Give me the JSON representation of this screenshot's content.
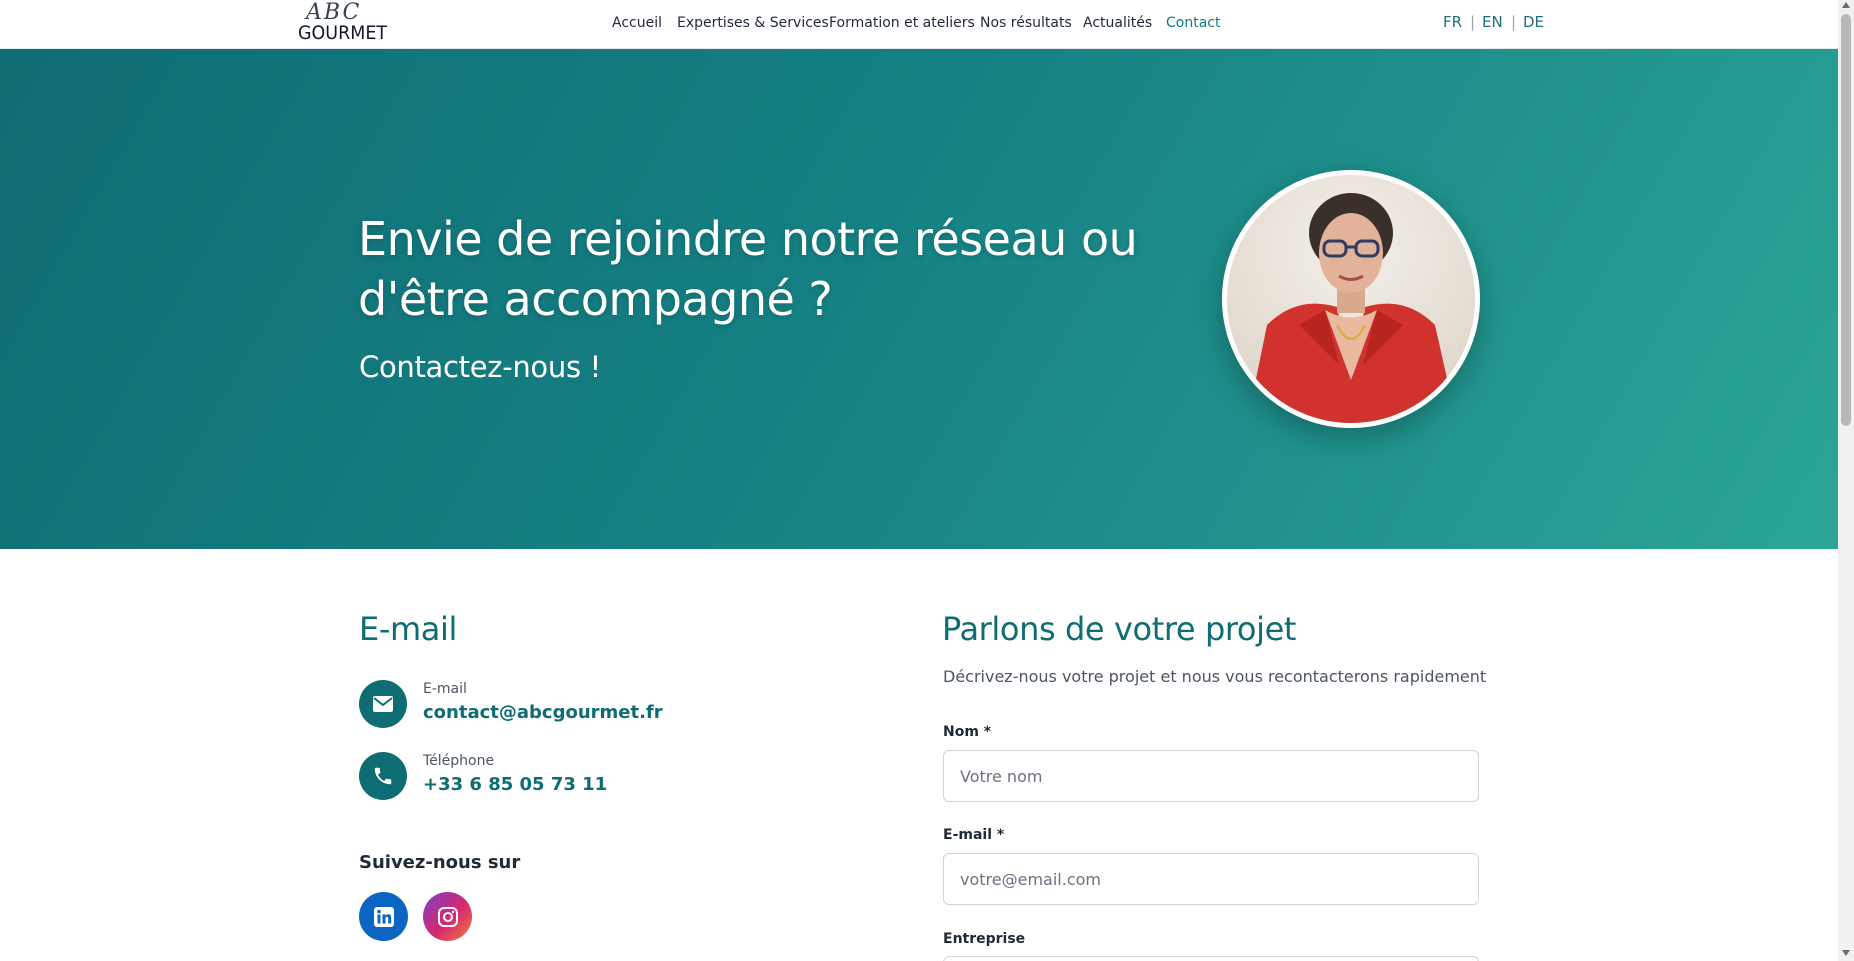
{
  "brand": {
    "logo_script": "ABC",
    "logo_word": "GOURMET"
  },
  "nav": {
    "items": [
      "Accueil",
      "Expertises & Services",
      "Formation et ateliers",
      "Nos résultats",
      "Actualités",
      "Contact"
    ],
    "active": "Contact"
  },
  "lang": {
    "fr": "FR",
    "en": "EN",
    "de": "DE",
    "sep": "|"
  },
  "hero": {
    "title": "Envie de rejoindre notre réseau ou d'être accompagné ?",
    "subtitle": "Contactez-nous !"
  },
  "contact": {
    "heading": "E-mail",
    "email_label": "E-mail",
    "email_value": "contact@abcgourmet.fr",
    "phone_label": "Téléphone",
    "phone_value": "+33 6 85 05 73 11",
    "follow": "Suivez-nous sur",
    "social": [
      "linkedin-icon",
      "instagram-icon"
    ]
  },
  "form": {
    "heading": "Parlons de votre projet",
    "description": "Décrivez-nous votre projet et nous vous recontacterons rapidement",
    "name_label": "Nom *",
    "name_placeholder": "Votre nom",
    "email_label": "E-mail *",
    "email_placeholder": "votre@email.com",
    "company_label": "Entreprise"
  },
  "colors": {
    "accent": "#0e6d72",
    "hero_start": "#0f6d74",
    "hero_end": "#2aa596",
    "linkedin": "#0a66c2"
  }
}
